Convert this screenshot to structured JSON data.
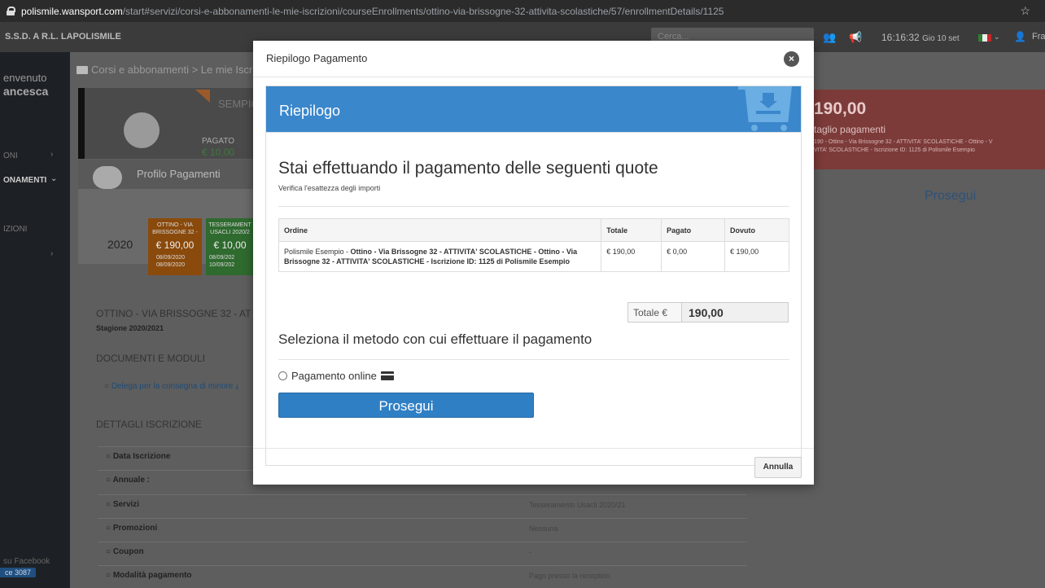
{
  "browser": {
    "url_host": "polismile.wansport.com",
    "url_path": "/start#servizi/corsi-e-abbonamenti-le-mie-iscrizioni/courseEnrollments/ottino-via-brissogne-32-attivita-scolastiche/57/enrollmentDetails/1125",
    "star_icon": "☆"
  },
  "header": {
    "brand": "S.S.D. A R.L. LAPOLISMILE",
    "search_placeholder": "Cerca...",
    "time": "16:16:32",
    "date": "Gio 10 set",
    "user_short": "Fra",
    "flag_colors": [
      "#2e7d32",
      "#eeeeee",
      "#c62828"
    ]
  },
  "sidebar": {
    "welcome": "envenuto",
    "user": "ancesca",
    "items": [
      {
        "label": "ONI"
      },
      {
        "label": "ONAMENTI"
      },
      {
        "label": "IZIONI"
      }
    ],
    "chevron_right": "›",
    "chevron_down": "⌄",
    "facebook": "su Facebook",
    "version": "ce 3087"
  },
  "background": {
    "breadcrumb": "Corsi e abbonamenti > Le mie Iscr",
    "esempio": "SEMPIO",
    "pagato_label": "PAGATO",
    "pagato_value": "€ 10,00",
    "profilo": "Profilo Pagamenti",
    "year": "2020",
    "tiles": [
      {
        "line1": "OTTINO - VIA",
        "line2": "BRISSOGNE 32 -",
        "amount": "€ 190,00",
        "d1": "08/09/2020",
        "d2": "08/09/2020",
        "color": "#8a4a0c"
      },
      {
        "line1": "TESSERAMENT",
        "line2": "USACLI 2020/2",
        "amount": "€ 10,00",
        "d1": "08/09/202",
        "d2": "10/09/202",
        "color": "#2f6a2f"
      }
    ],
    "course_title": "OTTINO - VIA BRISSOGNE 32 - AT",
    "stagione": "Stagione 2020/2021",
    "documenti": "DOCUMENTI E MODULI",
    "delega": "Delega per la consegna di minore",
    "dettagli": "DETTAGLI ISCRIZIONE",
    "rows": [
      {
        "label": "Data Iscrizione",
        "value": ""
      },
      {
        "label": "Annuale :",
        "value": ""
      },
      {
        "label": "Servizi",
        "value": "Tesseramento Usacli 2020/21"
      },
      {
        "label": "Promozioni",
        "value": "Nessuna"
      },
      {
        "label": "Coupon",
        "value": "-"
      },
      {
        "label": "Modalità pagamento",
        "value": "Pago presso la reception"
      }
    ],
    "red_amount": "190,00",
    "red_sub": "taglio pagamenti",
    "red_detail1": "190 - Ottino - Via Brissogne 32 - ATTIVITA' SCOLASTICHE - Ottino - V",
    "red_detail2": "VITA' SCOLASTICHE - Iscrizione ID: 1125 di Polismile Esempio",
    "prosegui": "Prosegui"
  },
  "modal": {
    "title": "Riepilogo Pagamento",
    "close_glyph": "×",
    "panel_title": "Riepilogo",
    "heading": "Stai effettuando il pagamento delle seguenti quote",
    "subheading": "Verifica l'esattezza degli importi",
    "table": {
      "headers": [
        "Ordine",
        "Totale",
        "Pagato",
        "Dovuto"
      ],
      "row": {
        "prefix": "Polismile Esempio - ",
        "bold": "Ottino - Via Brissogne 32 - ATTIVITA' SCOLASTICHE - Ottino - Via Brissogne 32 - ATTIVITA' SCOLASTICHE - Iscrizione ID: 1125 di Polismile Esempio",
        "totale": "€ 190,00",
        "pagato": "€ 0,00",
        "dovuto": "€ 190,00"
      }
    },
    "total_label": "Totale €",
    "total_value": "190,00",
    "method_heading": "Seleziona il metodo con cui effettuare il pagamento",
    "method_option": "Pagamento online",
    "prosegui": "Prosegui",
    "annulla": "Annulla"
  }
}
